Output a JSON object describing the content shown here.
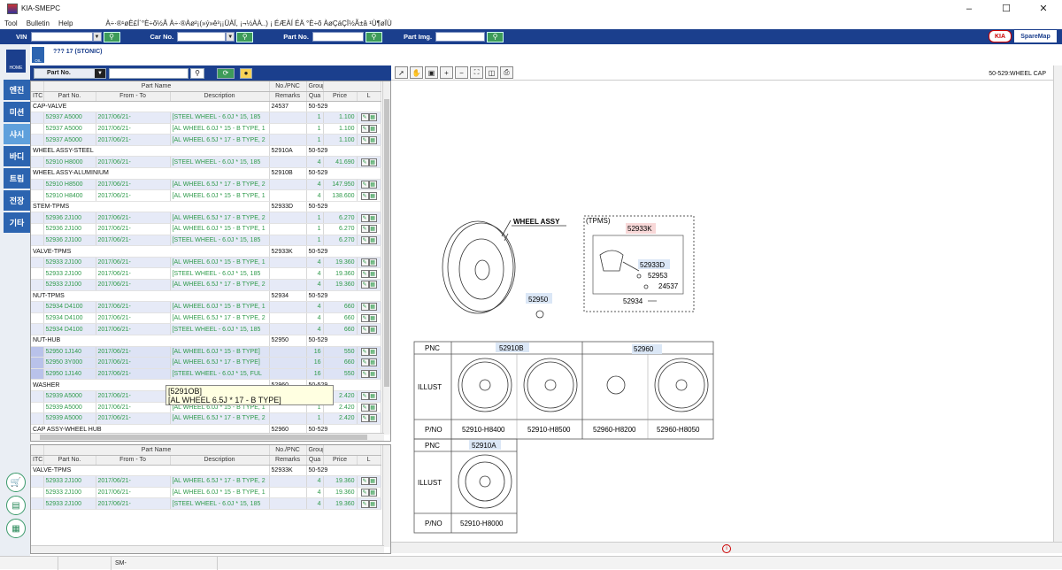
{
  "window": {
    "title": "KIA-SMEPC"
  },
  "menu": {
    "items": [
      "Tool",
      "Bulletin",
      "Help"
    ],
    "garbled_text": "À÷·®¹øÈ£Í´°È÷õ½Â À÷·®Àø²¡(»ý»ê³¡¡ÜÀÏ, ¡¬½ÀÀ..) ¡ ÉÆÀÍ ÉÄ °È÷õ ÀøÇáÇÏ½Ã±â ¹Ù¶øÏÙ"
  },
  "search": {
    "vin_label": "VIN",
    "car_label": "Car No.",
    "part_label": "Part No.",
    "img_label": "Part Img."
  },
  "logos": {
    "kia": "KIA",
    "sparemap": "SpareMap"
  },
  "sidebar": {
    "home_label": "HOME",
    "nav": [
      "엔진",
      "미션",
      "샤시",
      "바디",
      "트림",
      "전장",
      "기타"
    ],
    "active_index": 2,
    "tools": [
      "cart-icon",
      "document-icon",
      "clipboard-icon"
    ]
  },
  "vehicle": {
    "oil_label": "OIL",
    "name": "??? 17 (STONIC)"
  },
  "part_toolbar": {
    "select_value": "Part No."
  },
  "table_headers": {
    "top": [
      "",
      "Part Name",
      "",
      "No./PNC",
      "Group No.",
      "",
      "",
      ""
    ],
    "sub": [
      "ITC",
      "Part No.",
      "From - To",
      "Description",
      "Remarks",
      "Qua",
      "Price",
      "L"
    ]
  },
  "parts_table": [
    {
      "t": "g",
      "name": "CAP-VALVE",
      "pnc": "24537",
      "group": "50-529"
    },
    {
      "t": "i",
      "pn": "52937 A5000",
      "from": "2017/06/21-",
      "desc": "[STEEL WHEEL - 6.0J * 15, 185",
      "qty": "1",
      "price": "1.100"
    },
    {
      "t": "i",
      "pn": "52937 A5000",
      "from": "2017/06/21-",
      "desc": "[AL WHEEL 6.0J * 15 - B TYPE, 1",
      "qty": "1",
      "price": "1.100"
    },
    {
      "t": "i",
      "pn": "52937 A5000",
      "from": "2017/06/21-",
      "desc": "[AL WHEEL 6.5J * 17 - B TYPE, 2",
      "qty": "1",
      "price": "1.100"
    },
    {
      "t": "g",
      "name": "WHEEL ASSY-STEEL",
      "pnc": "52910A",
      "group": "50-529"
    },
    {
      "t": "i",
      "pn": "52910 H8000",
      "from": "2017/06/21-",
      "desc": "[STEEL WHEEL - 6.0J * 15, 185",
      "qty": "4",
      "price": "41.690"
    },
    {
      "t": "g",
      "name": "WHEEL ASSY-ALUMINIUM",
      "pnc": "52910B",
      "group": "50-529"
    },
    {
      "t": "i",
      "pn": "52910 H8500",
      "from": "2017/06/21-",
      "desc": "[AL WHEEL 6.5J * 17 - B TYPE, 2",
      "qty": "4",
      "price": "147.950"
    },
    {
      "t": "i",
      "pn": "52910 H8400",
      "from": "2017/06/21-",
      "desc": "[AL WHEEL 6.0J * 15 - B TYPE, 1",
      "qty": "4",
      "price": "138.600"
    },
    {
      "t": "g",
      "name": "STEM-TPMS",
      "pnc": "52933D",
      "group": "50-529"
    },
    {
      "t": "i",
      "pn": "52936 2J100",
      "from": "2017/06/21-",
      "desc": "[AL WHEEL 6.5J * 17 - B TYPE, 2",
      "qty": "1",
      "price": "6.270"
    },
    {
      "t": "i",
      "pn": "52936 2J100",
      "from": "2017/06/21-",
      "desc": "[AL WHEEL 6.0J * 15 - B TYPE, 1",
      "qty": "1",
      "price": "6.270"
    },
    {
      "t": "i",
      "pn": "52936 2J100",
      "from": "2017/06/21-",
      "desc": "[STEEL WHEEL - 6.0J * 15, 185",
      "qty": "1",
      "price": "6.270"
    },
    {
      "t": "g",
      "name": "VALVE-TPMS",
      "pnc": "52933K",
      "group": "50-529"
    },
    {
      "t": "i",
      "pn": "52933 2J100",
      "from": "2017/06/21-",
      "desc": "[AL WHEEL 6.0J * 15 - B TYPE, 1",
      "qty": "4",
      "price": "19.360"
    },
    {
      "t": "i",
      "pn": "52933 2J100",
      "from": "2017/06/21-",
      "desc": "[STEEL WHEEL - 6.0J * 15, 185",
      "qty": "4",
      "price": "19.360"
    },
    {
      "t": "i",
      "pn": "52933 2J100",
      "from": "2017/06/21-",
      "desc": "[AL WHEEL 6.5J * 17 - B TYPE, 2",
      "qty": "4",
      "price": "19.360"
    },
    {
      "t": "g",
      "name": "NUT-TPMS",
      "pnc": "52934",
      "group": "50-529"
    },
    {
      "t": "i",
      "pn": "52934 D4100",
      "from": "2017/06/21-",
      "desc": "[AL WHEEL 6.0J * 15 - B TYPE, 1",
      "qty": "4",
      "price": "660"
    },
    {
      "t": "i",
      "pn": "52934 D4100",
      "from": "2017/06/21-",
      "desc": "[AL WHEEL 6.5J * 17 - B TYPE, 2",
      "qty": "4",
      "price": "660"
    },
    {
      "t": "i",
      "pn": "52934 D4100",
      "from": "2017/06/21-",
      "desc": "[STEEL WHEEL - 6.0J * 15, 185",
      "qty": "4",
      "price": "660"
    },
    {
      "t": "g",
      "name": "NUT-HUB",
      "pnc": "52950",
      "group": "50-529"
    },
    {
      "t": "i",
      "hl": true,
      "pn": "52950 1J140",
      "from": "2017/06/21-",
      "desc": "[AL WHEEL 6.0J * 15 - B TYPE]",
      "qty": "16",
      "price": "550"
    },
    {
      "t": "i",
      "hl": true,
      "pn": "52950 3Y000",
      "from": "2017/06/21-",
      "desc": "[AL WHEEL 6.5J * 17 - B TYPE]",
      "qty": "16",
      "price": "660"
    },
    {
      "t": "i",
      "hl": true,
      "pn": "52950 1J140",
      "from": "2017/06/21-",
      "desc": "[STEEL WHEEL - 6.0J * 15, FUL",
      "qty": "16",
      "price": "550"
    },
    {
      "t": "g",
      "name": "WASHER",
      "pnc": "52960",
      "group": "50-529"
    },
    {
      "t": "i",
      "pn": "52939 A5000",
      "from": "2017/06/21-",
      "desc": "[STEEL WHEEL - 6.0J * 15, 185",
      "qty": "1",
      "price": "2.420"
    },
    {
      "t": "i",
      "pn": "52939 A5000",
      "from": "2017/06/21-",
      "desc": "[AL WHEEL 6.0J * 15 - B TYPE, 1",
      "qty": "1",
      "price": "2.420"
    },
    {
      "t": "i",
      "pn": "52939 A5000",
      "from": "2017/06/21-",
      "desc": "[AL WHEEL 6.5J * 17 - B TYPE, 2",
      "qty": "1",
      "price": "2.420"
    },
    {
      "t": "g",
      "name": "CAP ASSY-WHEEL HUB",
      "pnc": "52960",
      "group": "50-529"
    }
  ],
  "tooltip": {
    "line1": "[5291OB]",
    "line2": "[AL WHEEL 6.5J * 17 - B TYPE]"
  },
  "detail_table": [
    {
      "t": "g",
      "name": "VALVE-TPMS",
      "pnc": "52933K",
      "group": "50-529"
    },
    {
      "t": "i",
      "pn": "52933 2J100",
      "from": "2017/06/21-",
      "desc": "[AL WHEEL 6.5J * 17 - B TYPE, 2",
      "qty": "4",
      "price": "19.360"
    },
    {
      "t": "i",
      "pn": "52933 2J100",
      "from": "2017/06/21-",
      "desc": "[AL WHEEL 6.0J * 15 - B TYPE, 1",
      "qty": "4",
      "price": "19.360"
    },
    {
      "t": "i",
      "pn": "52933 2J100",
      "from": "2017/06/21-",
      "desc": "[STEEL WHEEL - 6.0J * 15, 185",
      "qty": "4",
      "price": "19.360"
    }
  ],
  "diagram": {
    "ref": "50-529:WHEEL CAP",
    "wheel_assy": "WHEEL ASSY",
    "tpms": "(TPMS)",
    "callouts": [
      "52933K",
      "52933D",
      "52953",
      "24537",
      "52934",
      "52950"
    ],
    "pnc_label": "PNC",
    "illust_label": "ILLUST",
    "pno_label": "P/NO",
    "grid1": {
      "pnc": [
        "52910B",
        "52960"
      ],
      "pno": [
        "52910-H8400",
        "52910-H8500",
        "52960-H8200",
        "52960-H8050"
      ]
    },
    "grid2": {
      "pnc": "52910A",
      "pno": "52910-H8000"
    }
  },
  "status": {
    "app_code": "SM-"
  }
}
